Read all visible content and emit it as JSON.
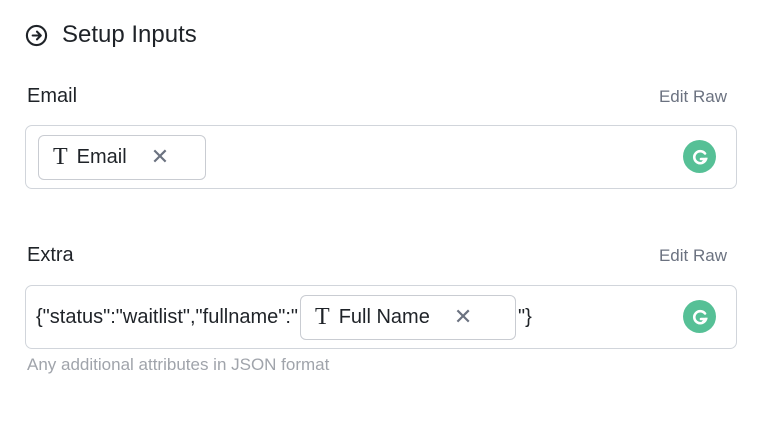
{
  "section": {
    "title": "Setup Inputs",
    "icon": "arrow-right-circle-icon"
  },
  "fields": [
    {
      "label": "Email",
      "edit_raw": "Edit Raw",
      "chip": {
        "label": "Email",
        "icon": "text-type-icon"
      }
    },
    {
      "label": "Extra",
      "edit_raw": "Edit Raw",
      "prefix": "{\"status\":\"waitlist\",\"fullname\":\"",
      "chip": {
        "label": "Full Name",
        "icon": "text-type-icon"
      },
      "suffix": "\"}",
      "helper": "Any additional attributes in JSON format"
    }
  ],
  "colors": {
    "grammarly": "#56c096",
    "border": "#d1d5db",
    "muted": "#6b7280"
  }
}
